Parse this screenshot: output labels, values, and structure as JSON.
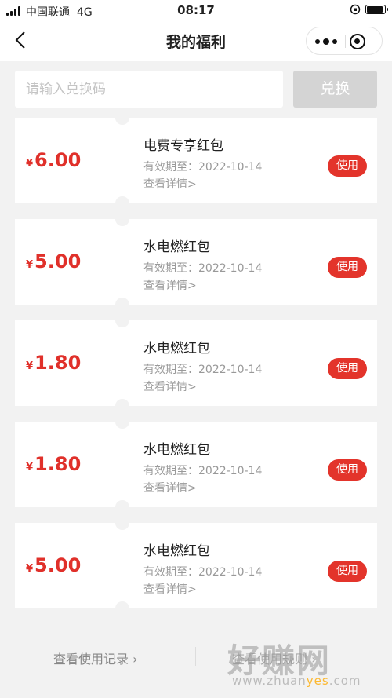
{
  "status_bar": {
    "carrier": "中国联通",
    "network": "4G",
    "time": "08:17"
  },
  "nav": {
    "title": "我的福利",
    "icons": [
      "back-arrow-icon",
      "more-dots-icon",
      "target-close-icon"
    ]
  },
  "redeem": {
    "placeholder": "请输入兑换码",
    "button_label": "兑换"
  },
  "coupons": [
    {
      "currency": "¥",
      "amount": "6.00",
      "name": "电费专享红包",
      "expiry": "有效期至：2022-10-14",
      "detail": "查看详情>",
      "action": "使用"
    },
    {
      "currency": "¥",
      "amount": "5.00",
      "name": "水电燃红包",
      "expiry": "有效期至：2022-10-14",
      "detail": "查看详情>",
      "action": "使用"
    },
    {
      "currency": "¥",
      "amount": "1.80",
      "name": "水电燃红包",
      "expiry": "有效期至：2022-10-14",
      "detail": "查看详情>",
      "action": "使用"
    },
    {
      "currency": "¥",
      "amount": "1.80",
      "name": "水电燃红包",
      "expiry": "有效期至：2022-10-14",
      "detail": "查看详情>",
      "action": "使用"
    },
    {
      "currency": "¥",
      "amount": "5.00",
      "name": "水电燃红包",
      "expiry": "有效期至：2022-10-14",
      "detail": "查看详情>",
      "action": "使用"
    }
  ],
  "footer": {
    "history_link": "查看使用记录",
    "other_link": "查看使用规则"
  },
  "watermark": {
    "text": "好赚网",
    "url_prefix": "www.zhuan",
    "url_highlight": "yes",
    "url_suffix": ".com"
  },
  "colors": {
    "accent": "#e3342b",
    "amount": "#e0302a",
    "background": "#f2f2f2",
    "disabled_button": "#d4d4d4"
  }
}
